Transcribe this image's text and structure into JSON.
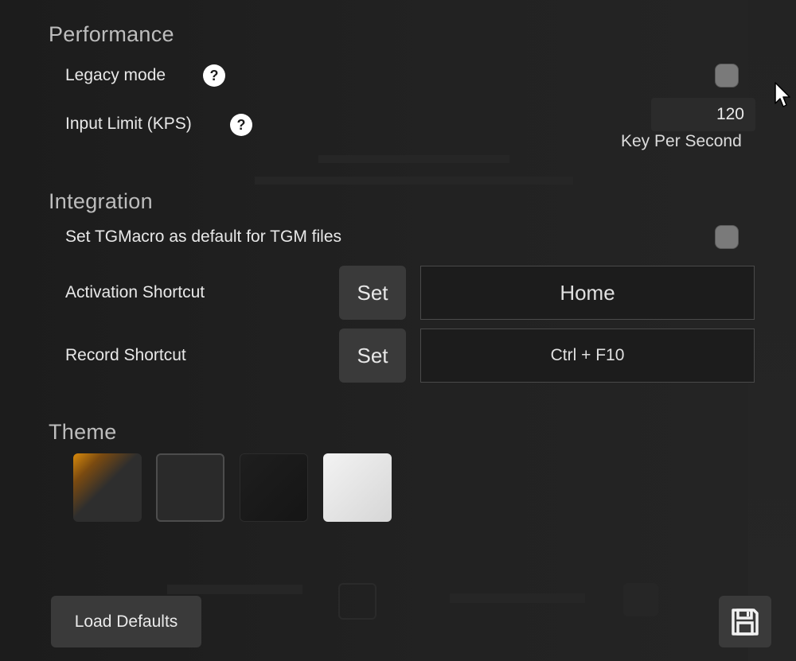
{
  "performance": {
    "title": "Performance",
    "legacy_mode_label": "Legacy mode",
    "input_limit_label": "Input Limit (KPS)",
    "input_limit_value": "120",
    "input_limit_unit": "Key Per Second",
    "help_glyph": "?"
  },
  "integration": {
    "title": "Integration",
    "default_tgm_label": "Set TGMacro as default for TGM files",
    "activation_label": "Activation Shortcut",
    "activation_set": "Set",
    "activation_value": "Home",
    "record_label": "Record Shortcut",
    "record_set": "Set",
    "record_value": "Ctrl + F10"
  },
  "theme": {
    "title": "Theme",
    "swatches": [
      "orange-dark",
      "dark-gray",
      "black",
      "light"
    ]
  },
  "footer": {
    "load_defaults_label": "Load Defaults"
  },
  "icons": {
    "help": "question-circle-icon",
    "save": "floppy-disk-icon",
    "cursor": "mouse-cursor-icon"
  },
  "colors": {
    "background": "#1f1f1f",
    "button": "#3a3a3a",
    "checkbox": "#7a7a7a",
    "accent_orange": "#d98a0b"
  }
}
